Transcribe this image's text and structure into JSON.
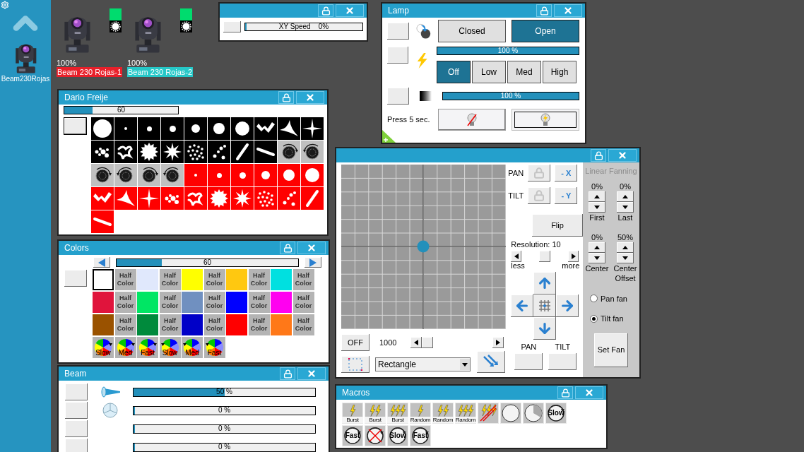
{
  "sidebar": {
    "label": "Beam230Rojas"
  },
  "fixtures": [
    {
      "reading": "100%",
      "name": "Beam 230 Rojas-1",
      "color": "#e8202a"
    },
    {
      "reading": "100%",
      "name": "Beam 230 Rojas-2",
      "color": "#26c8c8"
    }
  ],
  "speed_window": {
    "slider": {
      "label": "XY Speed",
      "reading": "0%",
      "level": 0
    }
  },
  "lamp": {
    "title": "Lamp",
    "shutter": [
      {
        "label": "Closed",
        "selected": false
      },
      {
        "label": "Open",
        "selected": true
      }
    ],
    "dimmer": {
      "reading": "100 %",
      "level": 1
    },
    "strobe": [
      {
        "label": "Off",
        "selected": true
      },
      {
        "label": "Low",
        "selected": false
      },
      {
        "label": "Med",
        "selected": false
      },
      {
        "label": "High",
        "selected": false
      }
    ],
    "fader": {
      "reading": "100 %",
      "level": 1
    },
    "hint": "Press 5 sec.",
    "lamp_buttons": [
      {
        "kind": "off",
        "selected": false
      },
      {
        "kind": "on",
        "selected": true
      }
    ]
  },
  "gobos": {
    "title": "Dario Freije",
    "slider": {
      "reading": "60",
      "level": 0.25
    },
    "items": [
      {
        "color": "#000000",
        "kind": "c7"
      },
      {
        "color": "#000000",
        "kind": "c1"
      },
      {
        "color": "#000000",
        "kind": "c2"
      },
      {
        "color": "#000000",
        "kind": "c3"
      },
      {
        "color": "#000000",
        "kind": "c4"
      },
      {
        "color": "#000000",
        "kind": "c5"
      },
      {
        "color": "#000000",
        "kind": "c6"
      },
      {
        "color": "#000000",
        "kind": "broken"
      },
      {
        "color": "#000000",
        "kind": "tri"
      },
      {
        "color": "#000000",
        "kind": "star"
      },
      {
        "color": "#000000",
        "kind": "dots"
      },
      {
        "color": "#000000",
        "kind": "swirl"
      },
      {
        "color": "#000000",
        "kind": "burst"
      },
      {
        "color": "#000000",
        "kind": "splat"
      },
      {
        "color": "#000000",
        "kind": "scatter"
      },
      {
        "color": "#000000",
        "kind": "sparse"
      },
      {
        "color": "#000000",
        "kind": "rising"
      },
      {
        "color": "#000000",
        "kind": "falling"
      },
      {
        "color": "#c0c0c0",
        "kind": "clockwise"
      },
      {
        "color": "#c0c0c0",
        "kind": "anticlockwise"
      },
      {
        "color": "#c0c0c0",
        "kind": "clockwise"
      },
      {
        "color": "#c0c0c0",
        "kind": "anticlockwise"
      },
      {
        "color": "#c0c0c0",
        "kind": "clockwise"
      },
      {
        "color": "#c0c0c0",
        "kind": "anticlockwise"
      },
      {
        "color": "#ff0000",
        "kind": "c1"
      },
      {
        "color": "#ff0000",
        "kind": "c2"
      },
      {
        "color": "#ff0000",
        "kind": "c3"
      },
      {
        "color": "#ff0000",
        "kind": "c4"
      },
      {
        "color": "#ff0000",
        "kind": "c5"
      },
      {
        "color": "#ff0000",
        "kind": "c6"
      },
      {
        "color": "#ff0000",
        "kind": "broken"
      },
      {
        "color": "#ff0000",
        "kind": "tri"
      },
      {
        "color": "#ff0000",
        "kind": "star"
      },
      {
        "color": "#ff0000",
        "kind": "dots"
      },
      {
        "color": "#ff0000",
        "kind": "swirl"
      },
      {
        "color": "#ff0000",
        "kind": "burst"
      },
      {
        "color": "#ff0000",
        "kind": "splat"
      },
      {
        "color": "#ff0000",
        "kind": "scatter"
      },
      {
        "color": "#ff0000",
        "kind": "sparse"
      },
      {
        "color": "#ff0000",
        "kind": "rising"
      },
      {
        "color": "#ff0000",
        "kind": "falling"
      }
    ]
  },
  "colors": {
    "title": "Colors",
    "slider": {
      "reading": "60",
      "level": 0.25
    },
    "items": [
      {
        "kind": "color",
        "color": "#ffffff",
        "selected": true
      },
      {
        "kind": "half",
        "label": "Half Color"
      },
      {
        "kind": "color",
        "color": "#e0e8fc",
        "selected": false
      },
      {
        "kind": "half",
        "label": "Half Color"
      },
      {
        "kind": "color",
        "color": "#ffff00",
        "selected": false
      },
      {
        "kind": "half",
        "label": "Half Color"
      },
      {
        "kind": "color",
        "color": "#ffc810",
        "selected": false
      },
      {
        "kind": "half",
        "label": "Half Color"
      },
      {
        "kind": "color",
        "color": "#00e0e0",
        "selected": false
      },
      {
        "kind": "half",
        "label": "Half Color"
      },
      {
        "kind": "color",
        "color": "#e0143c",
        "selected": false
      },
      {
        "kind": "half",
        "label": "Half Color"
      },
      {
        "kind": "color",
        "color": "#00e664",
        "selected": false
      },
      {
        "kind": "half",
        "label": "Half Color"
      },
      {
        "kind": "color",
        "color": "#7090c0",
        "selected": false
      },
      {
        "kind": "half",
        "label": "Half Color"
      },
      {
        "kind": "color",
        "color": "#0000ff",
        "selected": false
      },
      {
        "kind": "half",
        "label": "Half Color"
      },
      {
        "kind": "color",
        "color": "#ff00f0",
        "selected": false
      },
      {
        "kind": "half",
        "label": "Half Color"
      },
      {
        "kind": "color",
        "color": "#9a5200",
        "selected": false
      },
      {
        "kind": "half",
        "label": "Half Color"
      },
      {
        "kind": "color",
        "color": "#008a3c",
        "selected": false
      },
      {
        "kind": "half",
        "label": "Half Color"
      },
      {
        "kind": "color",
        "color": "#0000c8",
        "selected": false
      },
      {
        "kind": "half",
        "label": "Half Color"
      },
      {
        "kind": "color",
        "color": "#ff0000",
        "selected": false
      },
      {
        "kind": "half",
        "label": "Half Color"
      },
      {
        "kind": "color",
        "color": "#ff7818",
        "selected": false
      },
      {
        "kind": "half",
        "label": "Half Color"
      },
      {
        "kind": "forward",
        "label": "Slow"
      },
      {
        "kind": "forward",
        "label": "Med"
      },
      {
        "kind": "forward",
        "label": "Fast"
      },
      {
        "kind": "backward",
        "label": "Slow"
      },
      {
        "kind": "backward",
        "label": "Med"
      },
      {
        "kind": "backward",
        "label": "Fast"
      }
    ]
  },
  "beam": {
    "title": "Beam",
    "rows": [
      {
        "kind": "zoom",
        "reading": "50 %",
        "level": 0.5
      },
      {
        "kind": "prism",
        "reading": "0 %",
        "level": 0
      },
      {
        "kind": "plain",
        "reading": "0 %",
        "level": 0
      },
      {
        "kind": "plain",
        "reading": "0 %",
        "level": 0
      }
    ]
  },
  "xy": {
    "pan_label": "PAN",
    "tilt_label": "TILT",
    "invert_x": "- X",
    "invert_y": "- Y",
    "flip": "Flip",
    "resolution": {
      "label": "Resolution: 10",
      "level": 0.5
    },
    "less": "less",
    "more": "more",
    "off": "OFF",
    "speed": {
      "reading": "1000",
      "level": 0
    },
    "shape": "Rectangle",
    "pan_field_label": "PAN",
    "tilt_field_label": "TILT",
    "fanning": {
      "title": "Linear Fanning",
      "values": [
        {
          "reading": "0%",
          "label": "First"
        },
        {
          "reading": "0%",
          "label": "Last"
        },
        {
          "reading": "0%",
          "label": "Center"
        },
        {
          "reading": "50%",
          "label": "Center Offset"
        }
      ],
      "modes": [
        {
          "label": "Pan fan",
          "selected": false
        },
        {
          "label": "Tilt fan",
          "selected": true
        }
      ],
      "set": "Set Fan"
    }
  },
  "macros": {
    "title": "Macros",
    "items": [
      {
        "kind": "single",
        "label": "Burst"
      },
      {
        "kind": "double",
        "label": "Burst"
      },
      {
        "kind": "triple",
        "label": "Burst"
      },
      {
        "kind": "single",
        "label": "Random"
      },
      {
        "kind": "double",
        "label": "Random"
      },
      {
        "kind": "triple",
        "label": "Random"
      },
      {
        "kind": "noflash"
      },
      {
        "kind": "open"
      },
      {
        "kind": "half"
      },
      {
        "kind": "spin",
        "label": "Slow"
      },
      {
        "kind": "spin",
        "label": "Fast"
      },
      {
        "kind": "nospin"
      },
      {
        "kind": "spin",
        "label": "Slow"
      },
      {
        "kind": "spin",
        "label": "Fast"
      }
    ]
  }
}
